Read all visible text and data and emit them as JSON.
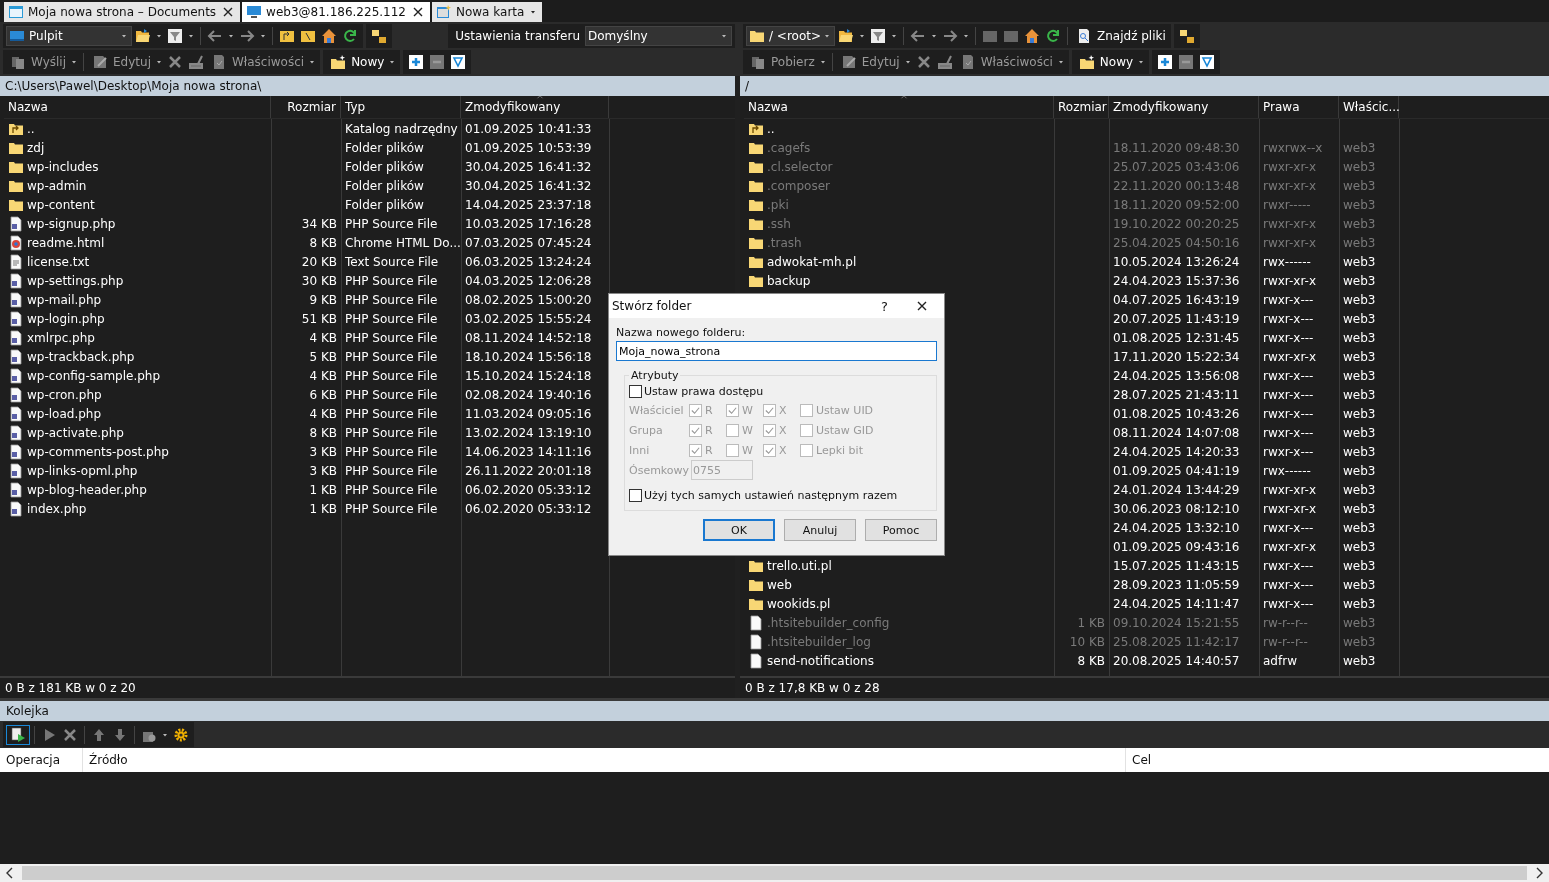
{
  "tabs": [
    {
      "label": "Moja nowa strona – Documents",
      "kind": "local",
      "selected": false
    },
    {
      "label": "web3@81.186.225.112",
      "kind": "remote",
      "selected": true
    },
    {
      "label": "Nowa karta",
      "kind": "new",
      "selected": false
    }
  ],
  "left_panel": {
    "location": "Pulpit",
    "transfer_label": "Ustawienia transferu",
    "transfer_value": "Domyślny",
    "actions": [
      {
        "label": "Wyślij",
        "disabled": true
      },
      {
        "label": "Edytuj",
        "disabled": true
      },
      {
        "label": "Właściwości",
        "disabled": true
      },
      {
        "label": "Nowy",
        "disabled": false
      }
    ],
    "path": "C:\\Users\\Pawel\\Desktop\\Moja nowa strona\\",
    "columns": [
      {
        "label": "Nazwa",
        "sorted": false
      },
      {
        "label": "Rozmiar",
        "sorted": false
      },
      {
        "label": "Typ",
        "sorted": false
      },
      {
        "label": "Zmodyfikowany",
        "sorted": true
      }
    ],
    "rows": [
      {
        "kind": "parent",
        "name": "..",
        "size": "",
        "type": "Katalog nadrzędny",
        "modified": "01.09.2025 10:41:33"
      },
      {
        "kind": "folder",
        "name": "zdj",
        "size": "",
        "type": "Folder plików",
        "modified": "01.09.2025 10:53:39"
      },
      {
        "kind": "folder",
        "name": "wp-includes",
        "size": "",
        "type": "Folder plików",
        "modified": "30.04.2025 16:41:32"
      },
      {
        "kind": "folder",
        "name": "wp-admin",
        "size": "",
        "type": "Folder plików",
        "modified": "30.04.2025 16:41:32"
      },
      {
        "kind": "folder",
        "name": "wp-content",
        "size": "",
        "type": "Folder plików",
        "modified": "14.04.2025 23:37:18"
      },
      {
        "kind": "php",
        "name": "wp-signup.php",
        "size": "34 KB",
        "type": "PHP Source File",
        "modified": "10.03.2025 17:16:28"
      },
      {
        "kind": "html",
        "name": "readme.html",
        "size": "8 KB",
        "type": "Chrome HTML Do...",
        "modified": "07.03.2025 07:45:24"
      },
      {
        "kind": "text",
        "name": "license.txt",
        "size": "20 KB",
        "type": "Text Source File",
        "modified": "06.03.2025 13:24:24"
      },
      {
        "kind": "php",
        "name": "wp-settings.php",
        "size": "30 KB",
        "type": "PHP Source File",
        "modified": "04.03.2025 12:06:28"
      },
      {
        "kind": "php",
        "name": "wp-mail.php",
        "size": "9 KB",
        "type": "PHP Source File",
        "modified": "08.02.2025 15:00:20"
      },
      {
        "kind": "php",
        "name": "wp-login.php",
        "size": "51 KB",
        "type": "PHP Source File",
        "modified": "03.02.2025 15:55:24"
      },
      {
        "kind": "php",
        "name": "xmlrpc.php",
        "size": "4 KB",
        "type": "PHP Source File",
        "modified": "08.11.2024 14:52:18"
      },
      {
        "kind": "php",
        "name": "wp-trackback.php",
        "size": "5 KB",
        "type": "PHP Source File",
        "modified": "18.10.2024 15:56:18"
      },
      {
        "kind": "php",
        "name": "wp-config-sample.php",
        "size": "4 KB",
        "type": "PHP Source File",
        "modified": "15.10.2024 15:24:18"
      },
      {
        "kind": "php",
        "name": "wp-cron.php",
        "size": "6 KB",
        "type": "PHP Source File",
        "modified": "02.08.2024 19:40:16"
      },
      {
        "kind": "php",
        "name": "wp-load.php",
        "size": "4 KB",
        "type": "PHP Source File",
        "modified": "11.03.2024 09:05:16"
      },
      {
        "kind": "php",
        "name": "wp-activate.php",
        "size": "8 KB",
        "type": "PHP Source File",
        "modified": "13.02.2024 13:19:10"
      },
      {
        "kind": "php",
        "name": "wp-comments-post.php",
        "size": "3 KB",
        "type": "PHP Source File",
        "modified": "14.06.2023 14:11:16"
      },
      {
        "kind": "php",
        "name": "wp-links-opml.php",
        "size": "3 KB",
        "type": "PHP Source File",
        "modified": "26.11.2022 20:01:18"
      },
      {
        "kind": "php",
        "name": "wp-blog-header.php",
        "size": "1 KB",
        "type": "PHP Source File",
        "modified": "06.02.2020 05:33:12"
      },
      {
        "kind": "php",
        "name": "index.php",
        "size": "1 KB",
        "type": "PHP Source File",
        "modified": "06.02.2020 05:33:12"
      }
    ],
    "status": "0 B z 181 KB w 0 z 20"
  },
  "right_panel": {
    "location": "/ <root>",
    "find_label": "Znajdź pliki",
    "actions": [
      {
        "label": "Pobierz",
        "disabled": true
      },
      {
        "label": "Edytuj",
        "disabled": true
      },
      {
        "label": "Właściwości",
        "disabled": true
      },
      {
        "label": "Nowy",
        "disabled": false
      }
    ],
    "path": "/",
    "columns": [
      {
        "label": "Nazwa",
        "sorted": true
      },
      {
        "label": "Rozmiar",
        "sorted": false
      },
      {
        "label": "Zmodyfikowany",
        "sorted": false
      },
      {
        "label": "Prawa",
        "sorted": false
      },
      {
        "label": "Właścic...",
        "sorted": false
      }
    ],
    "rows": [
      {
        "kind": "parent",
        "name": "..",
        "dimmed": false
      },
      {
        "kind": "folder",
        "name": ".cagefs",
        "modified": "18.11.2020 09:48:30",
        "rights": "rwxrwx--x",
        "owner": "web3",
        "dimmed": true
      },
      {
        "kind": "folder",
        "name": ".cl.selector",
        "modified": "25.07.2025 03:43:06",
        "rights": "rwxr-xr-x",
        "owner": "web3",
        "dimmed": true
      },
      {
        "kind": "folder",
        "name": ".composer",
        "modified": "22.11.2020 00:13:48",
        "rights": "rwxr-xr-x",
        "owner": "web3",
        "dimmed": true
      },
      {
        "kind": "folder",
        "name": ".pki",
        "modified": "18.11.2020 09:52:00",
        "rights": "rwxr-----",
        "owner": "web3",
        "dimmed": true
      },
      {
        "kind": "folder",
        "name": ".ssh",
        "modified": "19.10.2022 00:20:25",
        "rights": "rwxr-xr-x",
        "owner": "web3",
        "dimmed": true
      },
      {
        "kind": "folder",
        "name": ".trash",
        "modified": "25.04.2025 04:50:16",
        "rights": "rwxr-xr-x",
        "owner": "web3",
        "dimmed": true
      },
      {
        "kind": "folder",
        "name": "adwokat-mh.pl",
        "modified": "10.05.2024 13:26:24",
        "rights": "rwx------",
        "owner": "web3",
        "dimmed": false
      },
      {
        "kind": "folder",
        "name": "backup",
        "modified": "24.04.2023 15:37:36",
        "rights": "rwxr-xr-x",
        "owner": "web3",
        "dimmed": false
      },
      {
        "modified": "04.07.2025 16:43:19",
        "rights": "rwxr-x---",
        "owner": "web3",
        "dimmed": false
      },
      {
        "modified": "20.07.2025 11:43:19",
        "rights": "rwxr-x---",
        "owner": "web3",
        "dimmed": false
      },
      {
        "modified": "01.08.2025 12:31:45",
        "rights": "rwxr-x---",
        "owner": "web3",
        "dimmed": false
      },
      {
        "modified": "17.11.2020 15:22:34",
        "rights": "rwxr-xr-x",
        "owner": "web3",
        "dimmed": false
      },
      {
        "modified": "24.04.2025 13:56:08",
        "rights": "rwxr-x---",
        "owner": "web3",
        "dimmed": false
      },
      {
        "modified": "28.07.2025 21:43:11",
        "rights": "rwxr-x---",
        "owner": "web3",
        "dimmed": false
      },
      {
        "modified": "01.08.2025 10:43:26",
        "rights": "rwxr-x---",
        "owner": "web3",
        "dimmed": false
      },
      {
        "modified": "08.11.2024 14:07:08",
        "rights": "rwxr-x---",
        "owner": "web3",
        "dimmed": false
      },
      {
        "modified": "24.04.2025 14:20:33",
        "rights": "rwxr-x---",
        "owner": "web3",
        "dimmed": false
      },
      {
        "modified": "01.09.2025 04:41:19",
        "rights": "rwx------",
        "owner": "web3",
        "dimmed": false
      },
      {
        "modified": "24.01.2024 13:44:29",
        "rights": "rwxr-xr-x",
        "owner": "web3",
        "dimmed": false
      },
      {
        "modified": "30.06.2023 08:12:10",
        "rights": "rwxr-xr-x",
        "owner": "web3",
        "dimmed": false
      },
      {
        "modified": "24.04.2025 13:32:10",
        "rights": "rwxr-x---",
        "owner": "web3",
        "dimmed": false
      },
      {
        "modified": "01.09.2025 09:43:16",
        "rights": "rwxr-xr-x",
        "owner": "web3",
        "dimmed": false
      },
      {
        "kind": "folder",
        "name": "trello.uti.pl",
        "modified": "15.07.2025 11:43:15",
        "rights": "rwxr-x---",
        "owner": "web3",
        "dimmed": false
      },
      {
        "kind": "folder",
        "name": "web",
        "modified": "28.09.2023 11:05:59",
        "rights": "rwxr-x---",
        "owner": "web3",
        "dimmed": false
      },
      {
        "kind": "folder",
        "name": "wookids.pl",
        "modified": "24.04.2025 14:11:47",
        "rights": "rwxr-x---",
        "owner": "web3",
        "dimmed": false
      },
      {
        "kind": "file",
        "name": ".htsitebuilder_config",
        "size": "1 KB",
        "modified": "09.10.2024 15:21:55",
        "rights": "rw-r--r--",
        "owner": "web3",
        "dimmed": true
      },
      {
        "kind": "file",
        "name": ".htsitebuilder_log",
        "size": "10 KB",
        "modified": "25.08.2025 11:42:17",
        "rights": "rw-r--r--",
        "owner": "web3",
        "dimmed": true
      },
      {
        "kind": "file",
        "name": "send-notifications",
        "size": "8 KB",
        "modified": "20.08.2025 14:40:57",
        "rights": "adfrw",
        "owner": "web3",
        "dimmed": false
      }
    ],
    "status": "0 B z 17,8 KB w 0 z 28"
  },
  "queue": {
    "title": "Kolejka",
    "columns": [
      "Operacja",
      "Źródło",
      "Cel"
    ]
  },
  "dialog": {
    "title": "Stwórz folder",
    "help": "?",
    "name_label": "Nazwa nowego folderu:",
    "name_value": "Moja_nowa_strona",
    "group_label": "Atrybuty",
    "set_rights": {
      "label": "Ustaw prawa dostępu",
      "checked": false
    },
    "disabled": true,
    "permissions": [
      {
        "label": "Właściciel",
        "bits": [
          {
            "letter": "R",
            "checked": true
          },
          {
            "letter": "W",
            "checked": true
          },
          {
            "letter": "X",
            "checked": true
          }
        ],
        "special": {
          "label": "Ustaw UID",
          "checked": false
        }
      },
      {
        "label": "Grupa",
        "bits": [
          {
            "letter": "R",
            "checked": true
          },
          {
            "letter": "W",
            "checked": false
          },
          {
            "letter": "X",
            "checked": true
          }
        ],
        "special": {
          "label": "Ustaw GID",
          "checked": false
        }
      },
      {
        "label": "Inni",
        "bits": [
          {
            "letter": "R",
            "checked": true
          },
          {
            "letter": "W",
            "checked": false
          },
          {
            "letter": "X",
            "checked": true
          }
        ],
        "special": {
          "label": "Lepki bit",
          "checked": false
        }
      }
    ],
    "octal_label": "Ósemkowy",
    "octal_value": "0755",
    "reuse": {
      "label": "Użyj tych samych ustawień następnym razem",
      "checked": false
    },
    "buttons": [
      {
        "label": "OK",
        "default": true
      },
      {
        "label": "Anuluj",
        "default": false
      },
      {
        "label": "Pomoc",
        "default": false
      }
    ]
  }
}
